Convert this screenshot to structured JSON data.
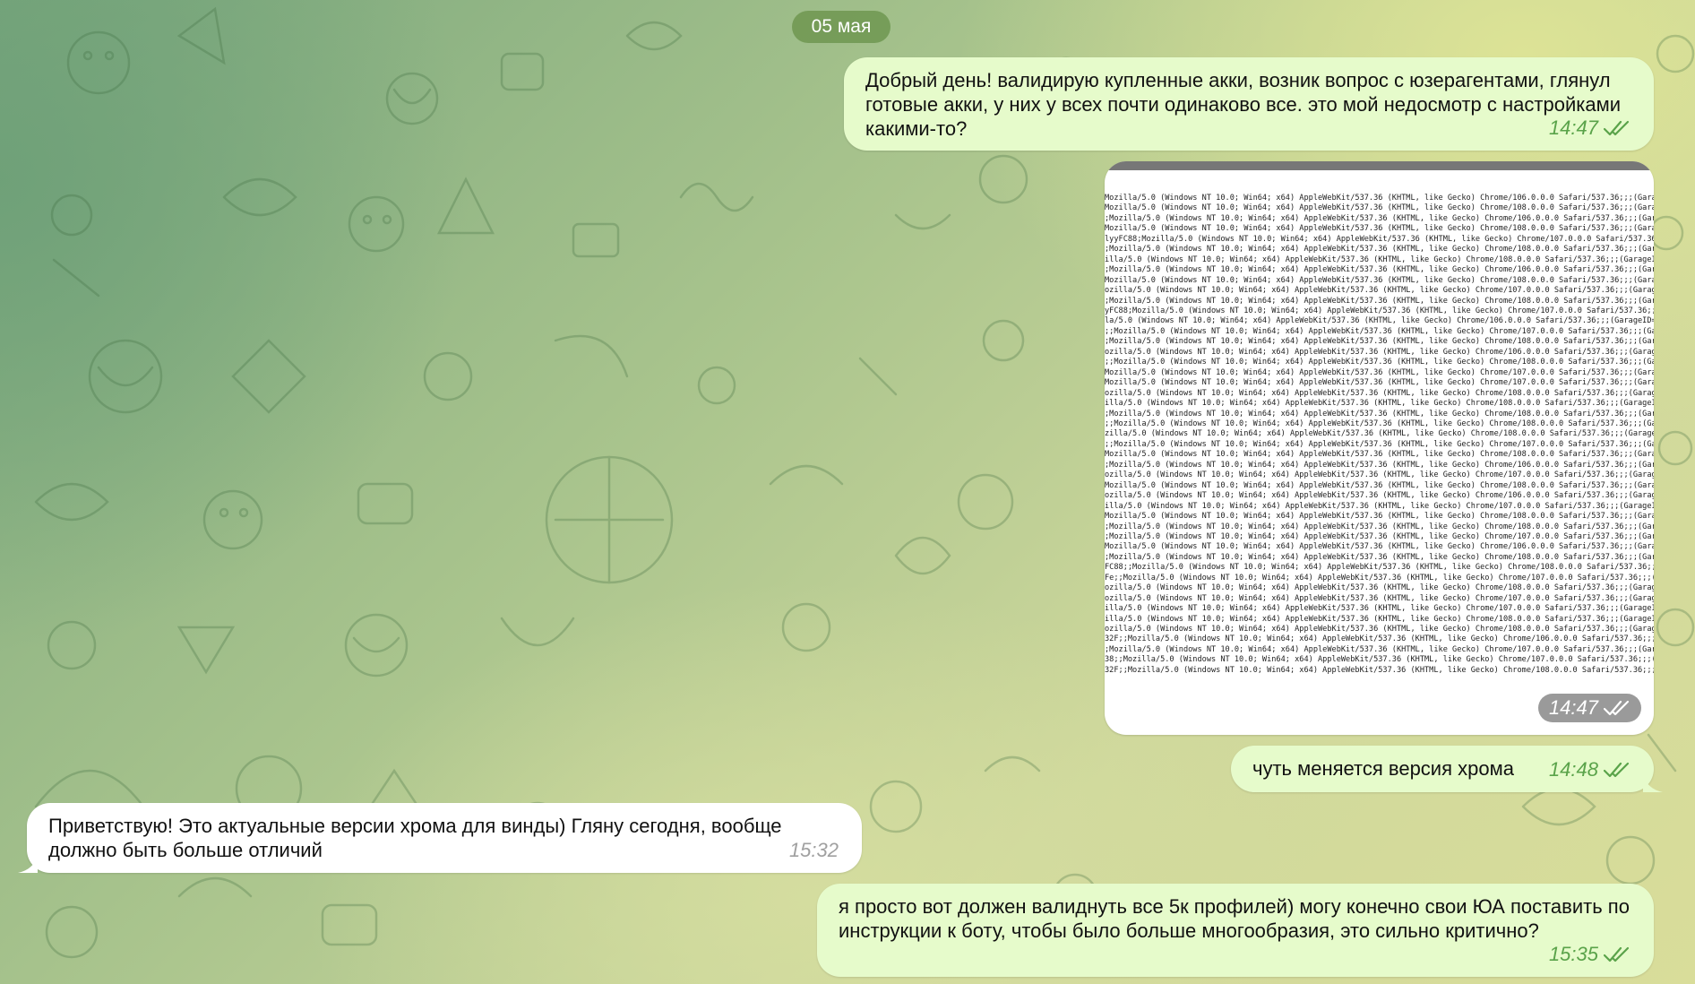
{
  "date_separator": "05 мая",
  "messages": [
    {
      "text": "Добрый день! валидирую купленные акки, возник вопрос с юзерагентами, глянул готовые акки, у них у всех почти одинаково все. это мой недосмотр с настройками какими-то?",
      "time": "14:47",
      "direction": "outgoing",
      "status": "read"
    },
    {
      "time": "14:47",
      "direction": "outgoing",
      "status": "read",
      "photo_lines": [
        "Mozilla/5.0 (Windows NT 10.0; Win64; x64) AppleWebKit/537.36 (KHTML, like Gecko) Chrome/106.0.0.0 Safari/537.36;;;(Garage",
        "Mozilla/5.0 (Windows NT 10.0; Win64; x64) AppleWebKit/537.36 (KHTML, like Gecko) Chrome/108.0.0.0 Safari/537.36;;;(Garage",
        ";Mozilla/5.0 (Windows NT 10.0; Win64; x64) AppleWebKit/537.36 (KHTML, like Gecko) Chrome/106.0.0.0 Safari/537.36;;;(Garag",
        "Mozilla/5.0 (Windows NT 10.0; Win64; x64) AppleWebKit/537.36 (KHTML, like Gecko) Chrome/108.0.0.0 Safari/537.36;;;(Garag",
        "lyyFC88;Mozilla/5.0 (Windows NT 10.0; Win64; x64) AppleWebKit/537.36 (KHTML, like Gecko) Chrome/107.0.0.0 Safari/537.36;",
        ";Mozilla/5.0 (Windows NT 10.0; Win64; x64) AppleWebKit/537.36 (KHTML, like Gecko) Chrome/108.0.0.0 Safari/537.36;;;(Garag",
        "illa/5.0 (Windows NT 10.0; Win64; x64) AppleWebKit/537.36 (KHTML, like Gecko) Chrome/108.0.0.0 Safari/537.36;;;(GarageID=",
        ";Mozilla/5.0 (Windows NT 10.0; Win64; x64) AppleWebKit/537.36 (KHTML, like Gecko) Chrome/106.0.0.0 Safari/537.36;;;(Garag",
        "Mozilla/5.0 (Windows NT 10.0; Win64; x64) AppleWebKit/537.36 (KHTML, like Gecko) Chrome/108.0.0.0 Safari/537.36;;;(Garag",
        "ozilla/5.0 (Windows NT 10.0; Win64; x64) AppleWebKit/537.36 (KHTML, like Gecko) Chrome/107.0.0.0 Safari/537.36;;;(Garage",
        ";Mozilla/5.0 (Windows NT 10.0; Win64; x64) AppleWebKit/537.36 (KHTML, like Gecko) Chrome/108.0.0.0 Safari/537.36;;;(Garag",
        "yFC88;Mozilla/5.0 (Windows NT 10.0; Win64; x64) AppleWebKit/537.36 (KHTML, like Gecko) Chrome/107.0.0.0 Safari/537.36;;;(",
        "la/5.0 (Windows NT 10.0; Win64; x64) AppleWebKit/537.36 (KHTML, like Gecko) Chrome/106.0.0.0 Safari/537.36;;;(GarageID=a",
        ";;Mozilla/5.0 (Windows NT 10.0; Win64; x64) AppleWebKit/537.36 (KHTML, like Gecko) Chrome/107.0.0.0 Safari/537.36;;;(Gar",
        ";Mozilla/5.0 (Windows NT 10.0; Win64; x64) AppleWebKit/537.36 (KHTML, like Gecko) Chrome/108.0.0.0 Safari/537.36;;;(Gara",
        "ozilla/5.0 (Windows NT 10.0; Win64; x64) AppleWebKit/537.36 (KHTML, like Gecko) Chrome/106.0.0.0 Safari/537.36;;;(Garage",
        ";;Mozilla/5.0 (Windows NT 10.0; Win64; x64) AppleWebKit/537.36 (KHTML, like Gecko) Chrome/108.0.0.0 Safari/537.36;;;(Gar",
        "Mozilla/5.0 (Windows NT 10.0; Win64; x64) AppleWebKit/537.36 (KHTML, like Gecko) Chrome/107.0.0.0 Safari/537.36;;;(Garag",
        "Mozilla/5.0 (Windows NT 10.0; Win64; x64) AppleWebKit/537.36 (KHTML, like Gecko) Chrome/107.0.0.0 Safari/537.36;;;(Garag",
        "ozilla/5.0 (Windows NT 10.0; Win64; x64) AppleWebKit/537.36 (KHTML, like Gecko) Chrome/108.0.0.0 Safari/537.36;;;(Garage",
        "illa/5.0 (Windows NT 10.0; Win64; x64) AppleWebKit/537.36 (KHTML, like Gecko) Chrome/108.0.0.0 Safari/537.36;;;(GarageID",
        ";Mozilla/5.0 (Windows NT 10.0; Win64; x64) AppleWebKit/537.36 (KHTML, like Gecko) Chrome/108.0.0.0 Safari/537.36;;;(Garag",
        ";;Mozilla/5.0 (Windows NT 10.0; Win64; x64) AppleWebKit/537.36 (KHTML, like Gecko) Chrome/108.0.0.0 Safari/537.36;;;(Gar",
        "zilla/5.0 (Windows NT 10.0; Win64; x64) AppleWebKit/537.36 (KHTML, like Gecko) Chrome/108.0.0.0 Safari/537.36;;;(GarageI",
        ";;Mozilla/5.0 (Windows NT 10.0; Win64; x64) AppleWebKit/537.36 (KHTML, like Gecko) Chrome/107.0.0.0 Safari/537.36;;;(Gar",
        "Mozilla/5.0 (Windows NT 10.0; Win64; x64) AppleWebKit/537.36 (KHTML, like Gecko) Chrome/108.0.0.0 Safari/537.36;;;(Garag",
        ";Mozilla/5.0 (Windows NT 10.0; Win64; x64) AppleWebKit/537.36 (KHTML, like Gecko) Chrome/106.0.0.0 Safari/537.36;;;(Garag",
        "ozilla/5.0 (Windows NT 10.0; Win64; x64) AppleWebKit/537.36 (KHTML, like Gecko) Chrome/107.0.0.0 Safari/537.36;;;(GarageID",
        "Mozilla/5.0 (Windows NT 10.0; Win64; x64) AppleWebKit/537.36 (KHTML, like Gecko) Chrome/108.0.0.0 Safari/537.36;;;(Garag",
        "ozilla/5.0 (Windows NT 10.0; Win64; x64) AppleWebKit/537.36 (KHTML, like Gecko) Chrome/106.0.0.0 Safari/537.36;;;(Garage",
        "illa/5.0 (Windows NT 10.0; Win64; x64) AppleWebKit/537.36 (KHTML, like Gecko) Chrome/107.0.0.0 Safari/537.36;;;(GarageID",
        "Mozilla/5.0 (Windows NT 10.0; Win64; x64) AppleWebKit/537.36 (KHTML, like Gecko) Chrome/108.0.0.0 Safari/537.36;;;(Garag",
        ";Mozilla/5.0 (Windows NT 10.0; Win64; x64) AppleWebKit/537.36 (KHTML, like Gecko) Chrome/108.0.0.0 Safari/537.36;;;(Garag",
        ";Mozilla/5.0 (Windows NT 10.0; Win64; x64) AppleWebKit/537.36 (KHTML, like Gecko) Chrome/107.0.0.0 Safari/537.36;;;(Garag",
        "Mozilla/5.0 (Windows NT 10.0; Win64; x64) AppleWebKit/537.36 (KHTML, like Gecko) Chrome/106.0.0.0 Safari/537.36;;;(Garag",
        ";Mozilla/5.0 (Windows NT 10.0; Win64; x64) AppleWebKit/537.36 (KHTML, like Gecko) Chrome/108.0.0.0 Safari/537.36;;;(Garag",
        "FC88;;Mozilla/5.0 (Windows NT 10.0; Win64; x64) AppleWebKit/537.36 (KHTML, like Gecko) Chrome/108.0.0.0 Safari/537.36;;;(",
        "Fe;;Mozilla/5.0 (Windows NT 10.0; Win64; x64) AppleWebKit/537.36 (KHTML, like Gecko) Chrome/107.0.0.0 Safari/537.36;;;(Gar",
        "ozilla/5.0 (Windows NT 10.0; Win64; x64) AppleWebKit/537.36 (KHTML, like Gecko) Chrome/108.0.0.0 Safari/537.36;;;(GarageI",
        "ozilla/5.0 (Windows NT 10.0; Win64; x64) AppleWebKit/537.36 (KHTML, like Gecko) Chrome/107.0.0.0 Safari/537.36;;;(Garag",
        "illa/5.0 (Windows NT 10.0; Win64; x64) AppleWebKit/537.36 (KHTML, like Gecko) Chrome/107.0.0.0 Safari/537.36;;;(GarageID",
        "illa/5.0 (Windows NT 10.0; Win64; x64) AppleWebKit/537.36 (KHTML, like Gecko) Chrome/108.0.0.0 Safari/537.36;;;(GarageID",
        "ozilla/5.0 (Windows NT 10.0; Win64; x64) AppleWebKit/537.36 (KHTML, like Gecko) Chrome/108.0.0.0 Safari/537.36;;;(Garag",
        "32F;;Mozilla/5.0 (Windows NT 10.0; Win64; x64) AppleWebKit/537.36 (KHTML, like Gecko) Chrome/106.0.0.0 Safari/537.36;;;(",
        ";Mozilla/5.0 (Windows NT 10.0; Win64; x64) AppleWebKit/537.36 (KHTML, like Gecko) Chrome/107.0.0.0 Safari/537.36;;;(Garag",
        "38;;Mozilla/5.0 (Windows NT 10.0; Win64; x64) AppleWebKit/537.36 (KHTML, like Gecko) Chrome/107.0.0.0 Safari/537.36;;;(Ga",
        "32F;;Mozilla/5.0 (Windows NT 10.0; Win64; x64) AppleWebKit/537.36 (KHTML, like Gecko) Chrome/108.0.0.0 Safari/537.36;;;("
      ]
    },
    {
      "text": "чуть меняется версия хрома",
      "time": "14:48",
      "direction": "outgoing",
      "status": "read"
    },
    {
      "text": "Приветствую! Это актуальные версии хрома для винды) Гляну сегодня, вообще должно быть больше отличий",
      "time": "15:32",
      "direction": "incoming"
    },
    {
      "text": "я просто вот должен валиднуть все 5к профилей) могу конечно свои ЮА поставить по инструкции к боту, чтобы было больше многообразия, это сильно критично?",
      "time": "15:35",
      "direction": "outgoing",
      "status": "read"
    }
  ],
  "icons": {
    "read_receipt": "double-check-icon"
  },
  "colors": {
    "outgoing_bubble": "#e6fbcb",
    "incoming_bubble": "#ffffff",
    "outgoing_time": "#5aa34a",
    "incoming_time": "#a0a0a0",
    "date_pill": "#6e9650"
  }
}
